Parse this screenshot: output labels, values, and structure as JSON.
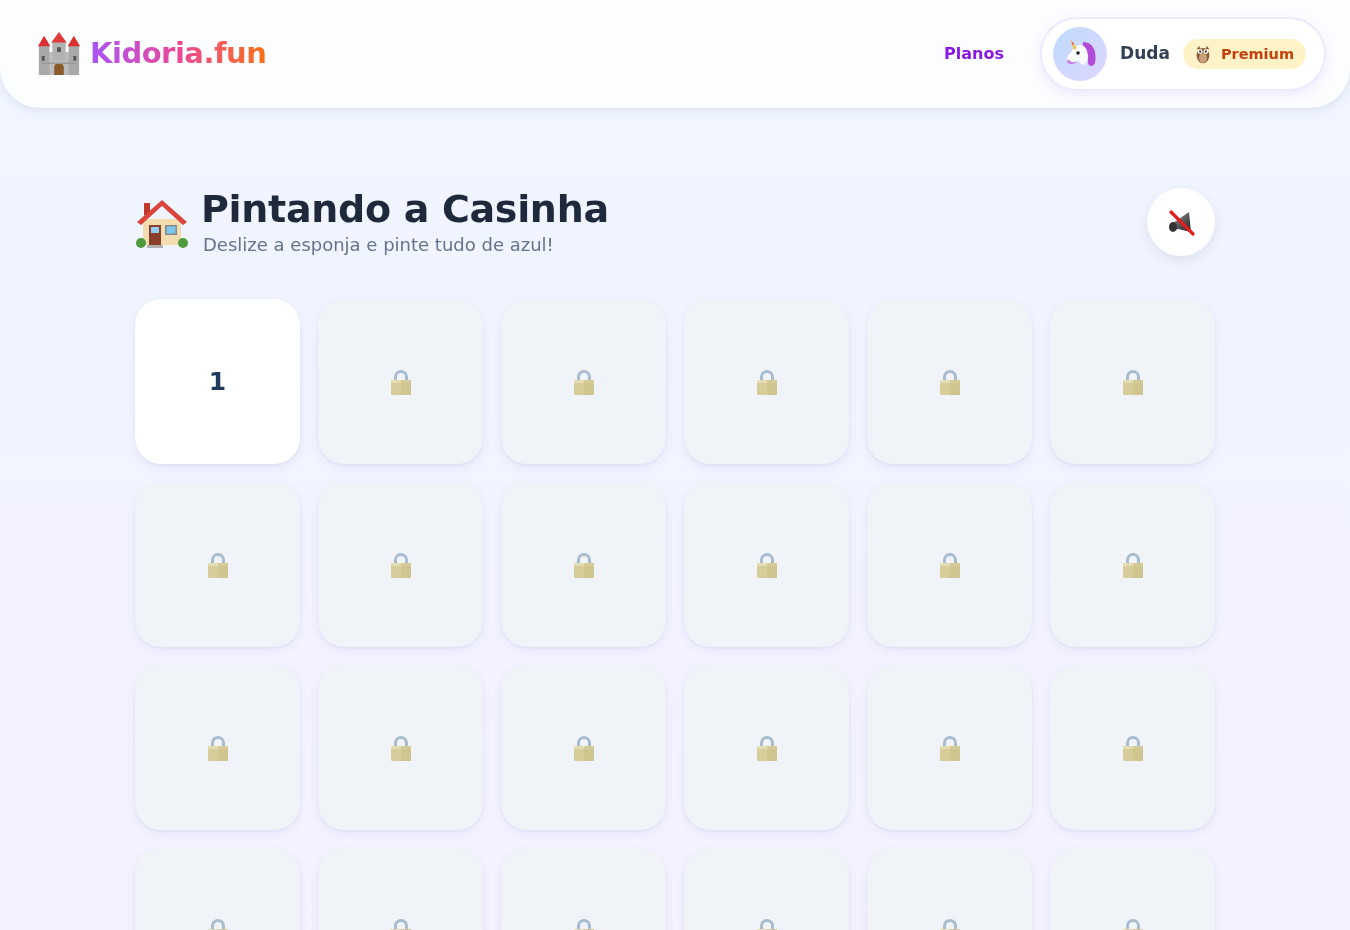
{
  "header": {
    "logo": "Kidoria.fun",
    "nav_link": "Planos",
    "user": {
      "name": "Duda",
      "plan": "Premium"
    }
  },
  "page": {
    "title": "Pintando a Casinha",
    "subtitle": "Deslize a esponja e pinte tudo de azul!"
  },
  "sound": {
    "muted": true
  },
  "levels": [
    {
      "number": "1",
      "locked": false
    },
    {
      "locked": true
    },
    {
      "locked": true
    },
    {
      "locked": true
    },
    {
      "locked": true
    },
    {
      "locked": true
    },
    {
      "locked": true
    },
    {
      "locked": true
    },
    {
      "locked": true
    },
    {
      "locked": true
    },
    {
      "locked": true
    },
    {
      "locked": true
    },
    {
      "locked": true
    },
    {
      "locked": true
    },
    {
      "locked": true
    },
    {
      "locked": true
    },
    {
      "locked": true
    },
    {
      "locked": true
    },
    {
      "locked": true
    },
    {
      "locked": true
    },
    {
      "locked": true
    },
    {
      "locked": true
    },
    {
      "locked": true
    },
    {
      "locked": true
    }
  ]
}
